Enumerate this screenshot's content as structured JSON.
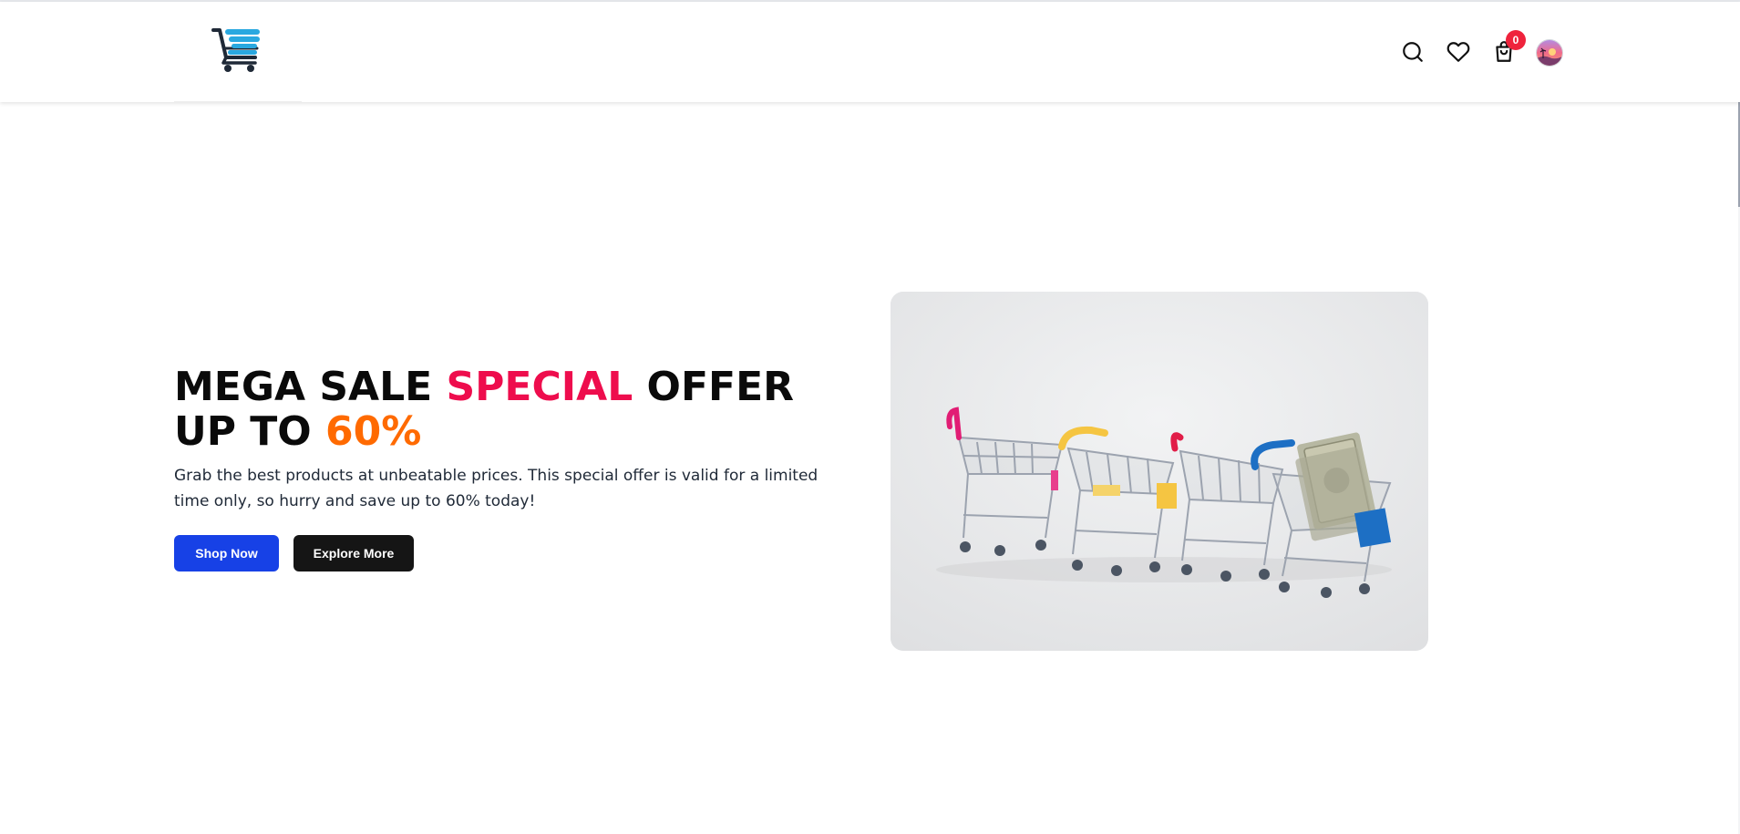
{
  "header": {
    "logo": {
      "icon": "shopping-cart-logo-icon",
      "colors": {
        "cart": "#1f2937",
        "stripes": "#29a8e0"
      }
    },
    "icons": [
      {
        "name": "search-icon"
      },
      {
        "name": "heart-icon"
      },
      {
        "name": "shopping-bag-icon"
      }
    ],
    "cart_count": "0",
    "avatar": {
      "icon": "user-avatar"
    }
  },
  "hero": {
    "title_parts": {
      "part1": "MEGA SALE ",
      "highlight1": "SPECIAL",
      "part2": " OFFER UP TO ",
      "highlight2": "60%"
    },
    "description": "Grab the best products at unbeatable prices. This special offer is valid for a limited time only, so hurry and save up to 60% today!",
    "buttons": {
      "primary": "Shop Now",
      "secondary": "Explore More"
    },
    "image": {
      "icon": "shopping-carts-with-money-image"
    }
  },
  "colors": {
    "highlight_red": "#ee0d4d",
    "highlight_orange": "#ff6a00",
    "primary_button": "#1741e6",
    "secondary_button": "#151515",
    "badge": "#ef233c"
  }
}
